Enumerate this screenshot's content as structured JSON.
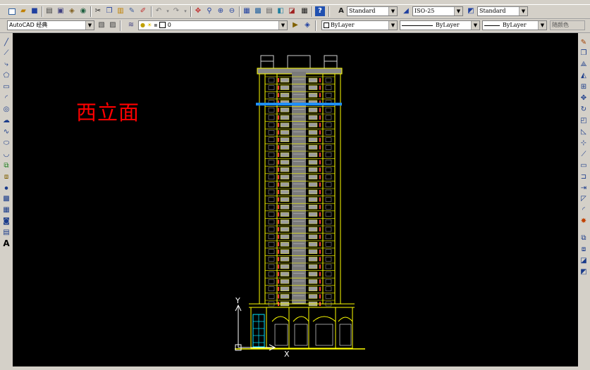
{
  "toolbar1": {
    "text_style": "Standard",
    "dim_style": "ISO-25",
    "table_style": "Standard"
  },
  "toolbar2": {
    "workspace": "AutoCAD 经典",
    "layer": "0",
    "color": "ByLayer",
    "linetype": "ByLayer",
    "lineweight": "ByLayer",
    "plotstyle": "随颜色"
  },
  "drawing": {
    "label": "西立面",
    "label_color": "#ff0000",
    "ucs_y": "Y",
    "ucs_x": "X"
  },
  "left_tools": [
    "line-icon",
    "construction-line-icon",
    "polyline-icon",
    "polygon-icon",
    "rectangle-icon",
    "arc-icon",
    "circle-icon",
    "revision-cloud-icon",
    "spline-icon",
    "ellipse-icon",
    "ellipse-arc-icon",
    "insert-block-icon",
    "make-block-icon",
    "point-icon",
    "hatch-icon",
    "gradient-icon",
    "region-icon",
    "table-icon",
    "multiline-text-icon"
  ],
  "right_tools": [
    "erase-icon",
    "copy-icon",
    "mirror-icon",
    "offset-icon",
    "array-icon",
    "move-icon",
    "rotate-icon",
    "scale-icon",
    "stretch-icon",
    "trim-icon",
    "extend-icon",
    "break-at-point-icon",
    "break-icon",
    "join-icon",
    "chamfer-icon",
    "fillet-icon",
    "explode-icon",
    "draworder-icon",
    "bring-front-icon",
    "send-back-icon",
    "bring-above-icon"
  ],
  "colors": {
    "canvas": "#000000",
    "building_lines": "#ffff00",
    "window_fill": "#9e9e9e",
    "highlight_band": "#1e90ff",
    "accent_red": "#ff3b3b"
  }
}
